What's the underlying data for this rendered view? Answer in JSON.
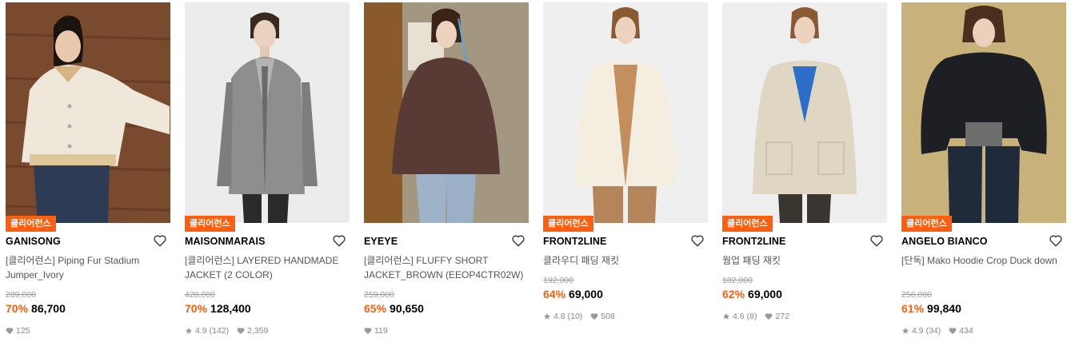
{
  "badge_label": "클리어런스",
  "colors": {
    "accent": "#ff5e0e",
    "muted": "#9e9e9e"
  },
  "products": [
    {
      "brand": "GANISONG",
      "name": "[클리어런스] Piping Fur Stadium Jumper_Ivory",
      "original_price": "289,000",
      "discount": "70%",
      "price": "86,700",
      "rating": "",
      "reviews": "",
      "likes": "125",
      "has_badge": true
    },
    {
      "brand": "MAISONMARAIS",
      "name": "[클리어런스] LAYERED HANDMADE JACKET (2 COLOR)",
      "original_price": "428,000",
      "discount": "70%",
      "price": "128,400",
      "rating": "4.9",
      "reviews": "(142)",
      "likes": "2,359",
      "has_badge": true
    },
    {
      "brand": "EYEYE",
      "name": "[클리어런스] FLUFFY SHORT JACKET_BROWN (EEOP4CTR02W)",
      "original_price": "259,000",
      "discount": "65%",
      "price": "90,650",
      "rating": "",
      "reviews": "",
      "likes": "119",
      "has_badge": false
    },
    {
      "brand": "FRONT2LINE",
      "name": "클라우디 패딩 재킷",
      "original_price": "192,000",
      "discount": "64%",
      "price": "69,000",
      "rating": "4.8",
      "reviews": "(10)",
      "likes": "508",
      "has_badge": true
    },
    {
      "brand": "FRONT2LINE",
      "name": "웜업 패딩 재킷",
      "original_price": "182,000",
      "discount": "62%",
      "price": "69,000",
      "rating": "4.6",
      "reviews": "(8)",
      "likes": "272",
      "has_badge": true
    },
    {
      "brand": "ANGELO BIANCO",
      "name": "[단독] Mako Hoodie Crop Duck down",
      "original_price": "256,000",
      "discount": "61%",
      "price": "99,840",
      "rating": "4.9",
      "reviews": "(34)",
      "likes": "434",
      "has_badge": true
    }
  ]
}
